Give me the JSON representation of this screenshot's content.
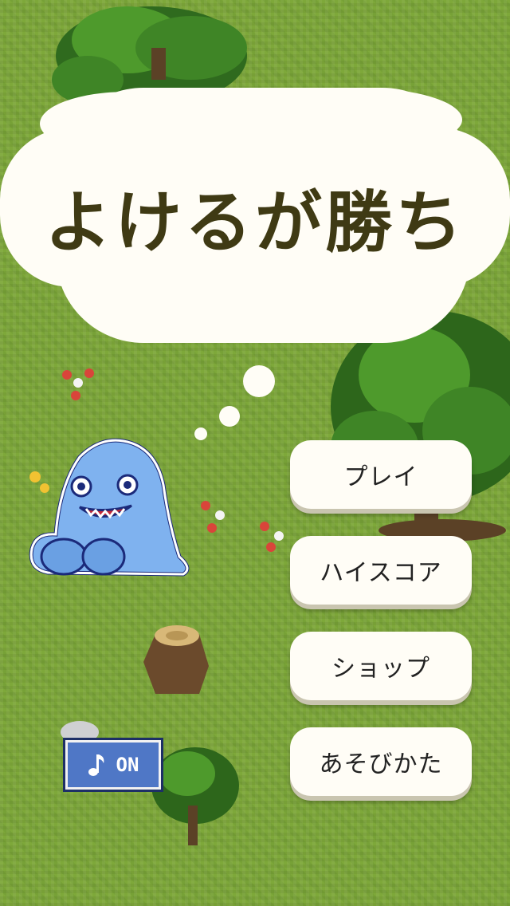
{
  "title": {
    "text": "よけるが勝ち"
  },
  "menu": {
    "play_label": "プレイ",
    "highscore_label": "ハイスコア",
    "shop_label": "ショップ",
    "howto_label": "あそびかた"
  },
  "sound": {
    "label": "ON",
    "icon": "music-note-icon"
  },
  "colors": {
    "grass": "#7ea83a",
    "cloud": "#fffdf6",
    "title_text": "#3f3a14",
    "character": "#7fb2ef",
    "sound_button": "#4f77c6"
  }
}
